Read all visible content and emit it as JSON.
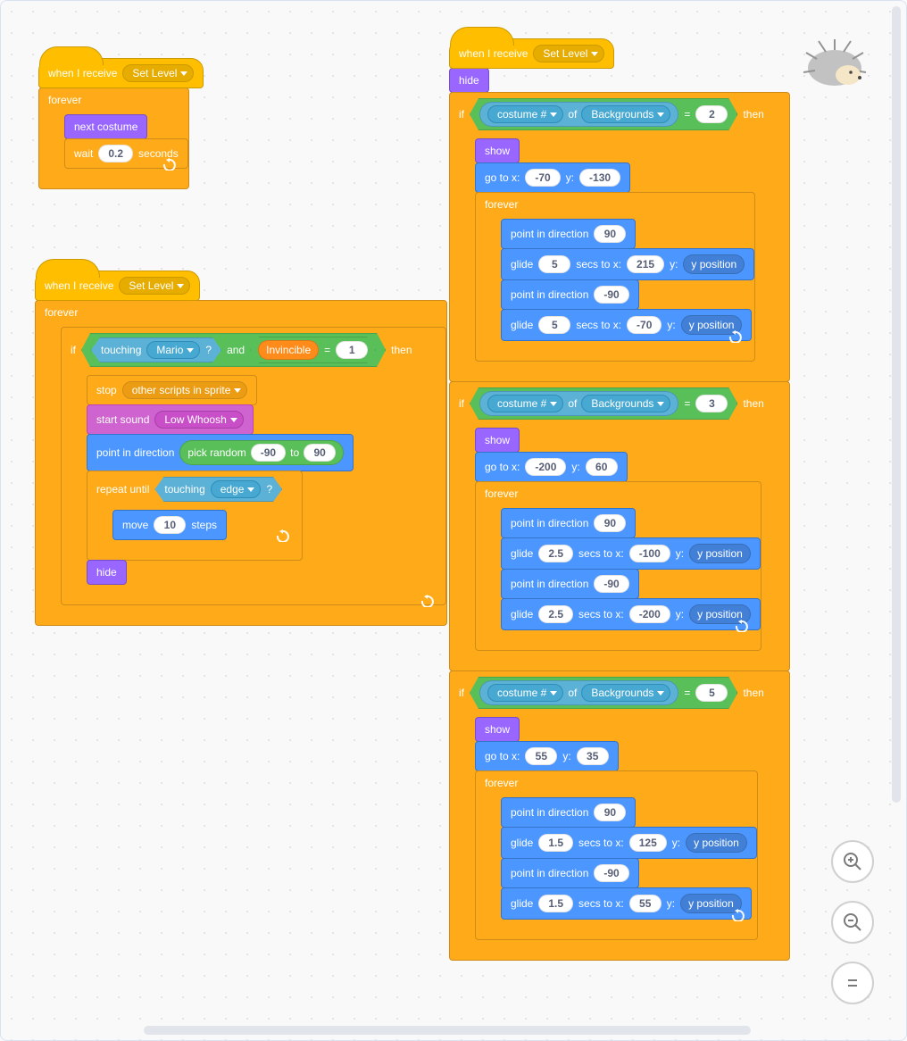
{
  "common": {
    "when_receive": "when I receive",
    "forever": "forever",
    "wait": "wait",
    "seconds": "seconds",
    "if": "if",
    "then": "then",
    "stop": "stop",
    "repeat_until": "repeat until",
    "and": "and",
    "equals": "=",
    "of": "of",
    "touching": "touching",
    "q": "?",
    "to": "to",
    "next_costume": "next costume",
    "hide": "hide",
    "show": "show",
    "goto_x": "go to x:",
    "y": "y:",
    "point_dir": "point in direction",
    "glide": "glide",
    "secs_to_x": "secs to x:",
    "y_pos": "y position",
    "move": "move",
    "steps": "steps",
    "start_sound": "start sound",
    "pick_random": "pick random",
    "costume_num": "costume #",
    "edge": "edge",
    "set_level": "Set Level",
    "backgrounds": "Backgrounds",
    "mario": "Mario",
    "invincible": "Invincible",
    "other_scripts": "other scripts in sprite",
    "low_whoosh": "Low Whoosh"
  },
  "script1": {
    "wait_val": "0.2"
  },
  "script2": {
    "invincible_eq": "1",
    "rand_lo": "-90",
    "rand_hi": "90",
    "move_steps": "10"
  },
  "script3": {
    "levels": [
      {
        "costume_eq": "2",
        "gx": "-70",
        "gy": "-130",
        "dir1": "90",
        "gsecs1": "5",
        "gx1": "215",
        "dir2": "-90",
        "gsecs2": "5",
        "gx2": "-70"
      },
      {
        "costume_eq": "3",
        "gx": "-200",
        "gy": "60",
        "dir1": "90",
        "gsecs1": "2.5",
        "gx1": "-100",
        "dir2": "-90",
        "gsecs2": "2.5",
        "gx2": "-200"
      },
      {
        "costume_eq": "5",
        "gx": "55",
        "gy": "35",
        "dir1": "90",
        "gsecs1": "1.5",
        "gx1": "125",
        "dir2": "-90",
        "gsecs2": "1.5",
        "gx2": "55"
      }
    ]
  }
}
